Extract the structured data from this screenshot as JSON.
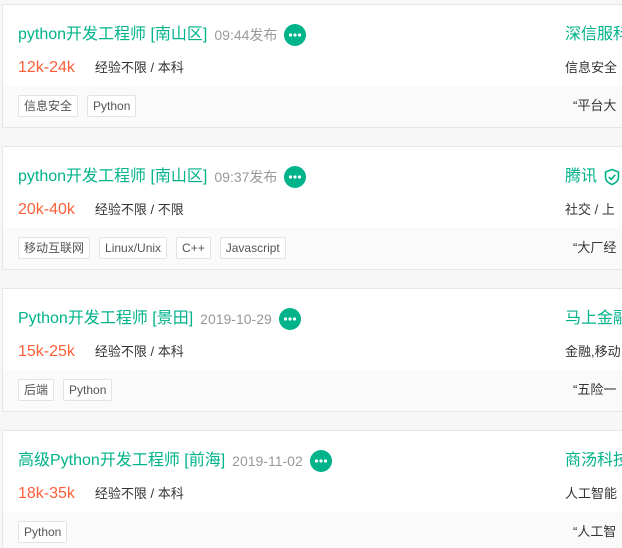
{
  "colors": {
    "accent": "#00b38a",
    "salary": "#fd5f39",
    "muted": "#999999",
    "text": "#333333"
  },
  "jobs": [
    {
      "title": "python开发工程师 [南山区]",
      "publish_time": "09:44发布",
      "salary": "12k-24k",
      "requirements": "经验不限 / 本科",
      "company": "深信服科",
      "company_verified": false,
      "industry": "信息安全",
      "tags": [
        "信息安全",
        "Python"
      ],
      "benefit": "“平台大"
    },
    {
      "title": "python开发工程师 [南山区]",
      "publish_time": "09:37发布",
      "salary": "20k-40k",
      "requirements": "经验不限 / 不限",
      "company": "腾讯",
      "company_verified": true,
      "industry": "社交 / 上",
      "tags": [
        "移动互联网",
        "Linux/Unix",
        "C++",
        "Javascript"
      ],
      "benefit": "“大厂经"
    },
    {
      "title": "Python开发工程师 [景田]",
      "publish_time": "2019-10-29",
      "salary": "15k-25k",
      "requirements": "经验不限 / 本科",
      "company": "马上金融",
      "company_verified": false,
      "industry": "金融,移动",
      "tags": [
        "后端",
        "Python"
      ],
      "benefit": "“五险一"
    },
    {
      "title": "高级Python开发工程师 [前海]",
      "publish_time": "2019-11-02",
      "salary": "18k-35k",
      "requirements": "经验不限 / 本科",
      "company": "商汤科技",
      "company_verified": false,
      "industry": "人工智能",
      "tags": [
        "Python"
      ],
      "benefit": "“人工智"
    }
  ]
}
